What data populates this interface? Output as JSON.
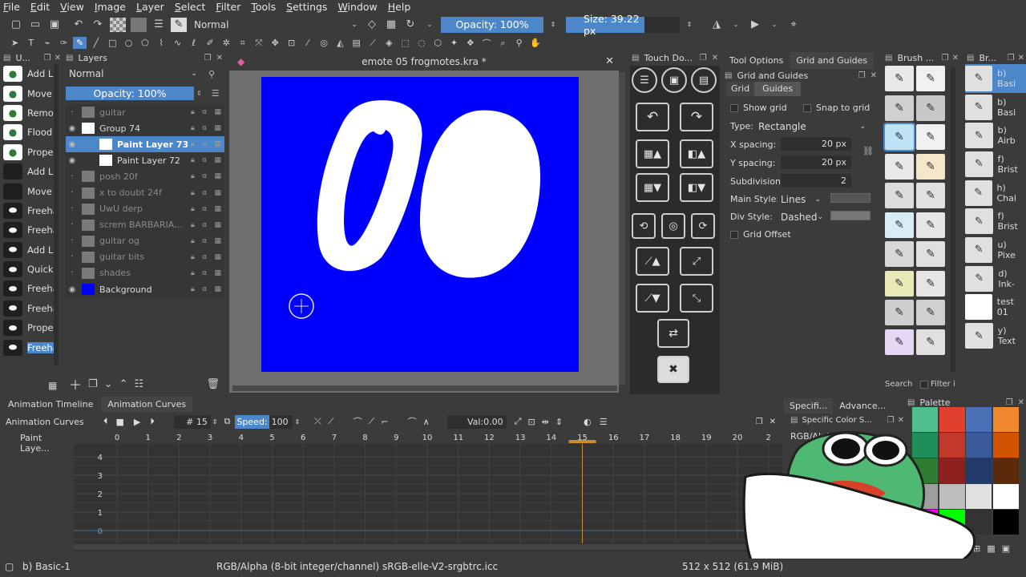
{
  "menu": [
    "File",
    "Edit",
    "View",
    "Image",
    "Layer",
    "Select",
    "Filter",
    "Tools",
    "Settings",
    "Window",
    "Help"
  ],
  "toolbar": {
    "blend_mode": "Normal",
    "opacity": "Opacity: 100%",
    "size": "Size: 39.22 px"
  },
  "tools_panel": {
    "title": "U...",
    "items": [
      {
        "label": "Add Li",
        "color": "#2c7a3c"
      },
      {
        "label": "Move",
        "color": "#2c7a3c"
      },
      {
        "label": "Remov",
        "color": "#2c7a3c"
      },
      {
        "label": "Flood",
        "color": "#2c7a3c"
      },
      {
        "label": "Prope",
        "color": "#2c7a3c"
      },
      {
        "label": "Add La"
      },
      {
        "label": "Move"
      },
      {
        "label": "Freeha"
      },
      {
        "label": "Freeha"
      },
      {
        "label": "Add La"
      },
      {
        "label": "Quick"
      },
      {
        "label": "Freeha"
      },
      {
        "label": "Freeha"
      },
      {
        "label": "Prope"
      },
      {
        "label": "Freeha"
      }
    ]
  },
  "layers": {
    "title": "Layers",
    "blend": "Normal",
    "opacity": "Opacity:  100%",
    "rows": [
      {
        "name": "guitar",
        "visible": false
      },
      {
        "name": "Group 74",
        "visible": true
      },
      {
        "name": "Paint Layer 73",
        "visible": true,
        "selected": true
      },
      {
        "name": "Paint Layer 72",
        "visible": true
      },
      {
        "name": "posh 20f",
        "visible": false
      },
      {
        "name": "x to doubt 24f",
        "visible": false
      },
      {
        "name": "UwU derp",
        "visible": false
      },
      {
        "name": "screm BARBARIA...",
        "visible": false
      },
      {
        "name": "guitar og",
        "visible": false
      },
      {
        "name": "guitar bits",
        "visible": false
      },
      {
        "name": "shades",
        "visible": false
      },
      {
        "name": "Background",
        "visible": true
      }
    ]
  },
  "document": {
    "title": "emote 05 frogmotes.kra *",
    "canvas_color": "#0000ff"
  },
  "touch_docker": {
    "title": "Touch Do..."
  },
  "grid_panel": {
    "tabs": [
      "Tool Options",
      "Grid and Guides"
    ],
    "title": "Grid and Guides",
    "subtabs": [
      "Grid",
      "Guides"
    ],
    "show_grid": "Show grid",
    "snap_grid": "Snap to grid",
    "type_label": "Type:",
    "type_value": "Rectangle",
    "x_spacing_label": "X spacing:",
    "x_spacing": "20 px",
    "y_spacing_label": "Y spacing:",
    "y_spacing": "20 px",
    "subdivision_label": "Subdivision:",
    "subdivision": "2",
    "main_style_label": "Main Style:",
    "main_style": "Lines",
    "div_style_label": "Div Style:",
    "div_style": "Dashed",
    "grid_offset": "Grid Offset"
  },
  "brushes": {
    "title": "Brush ...",
    "search": "Search",
    "filter": "Filter i"
  },
  "brush_presets": {
    "title": "Br...",
    "items": [
      "b) Basi",
      "b) Basi",
      "b) Airb",
      "f) Brist",
      "h) Chal",
      "f) Brist",
      "u) Pixe",
      "d) Ink-",
      "test 01",
      "y) Text"
    ]
  },
  "animation": {
    "tabs": [
      "Animation Timeline",
      "Animation Curves"
    ],
    "label": "Animation Curves",
    "frame": "# 15",
    "speed_label": "Speed:",
    "speed": "100 %",
    "val_label": "Val:",
    "val": "0.00",
    "channel": "Paint Laye...",
    "x_ticks": [
      "0",
      "1",
      "2",
      "3",
      "4",
      "5",
      "6",
      "7",
      "8",
      "9",
      "10",
      "11",
      "12",
      "13",
      "14",
      "15",
      "16",
      "17",
      "18",
      "19",
      "20",
      "2"
    ],
    "y_ticks": [
      "4",
      "3",
      "2",
      "1",
      "0"
    ]
  },
  "color_panel": {
    "tabs": [
      "Specifi...",
      "Advance..."
    ],
    "title": "Specific Color S...",
    "mode": "RGB/Alph"
  },
  "palette": {
    "title": "Palette",
    "colors": [
      "#4fc08d",
      "#e0412f",
      "#4a6fb5",
      "#f0892d",
      "#1f8f5a",
      "#c0392b",
      "#3a5a9a",
      "#d35400",
      "#2e7d32",
      "#8e2020",
      "#223a6a",
      "#5a2a0a",
      "#9e9e9e",
      "#bdbdbd",
      "#e0e0e0",
      "#ffffff",
      "#ff00ff",
      "#00ff00",
      "#333333",
      "#000000"
    ]
  },
  "status": {
    "brush": "b) Basic-1",
    "color_space": "RGB/Alpha (8-bit integer/channel)  sRGB-elle-V2-srgbtrc.icc",
    "size": "512 x 512 (61.9 MiB)"
  }
}
